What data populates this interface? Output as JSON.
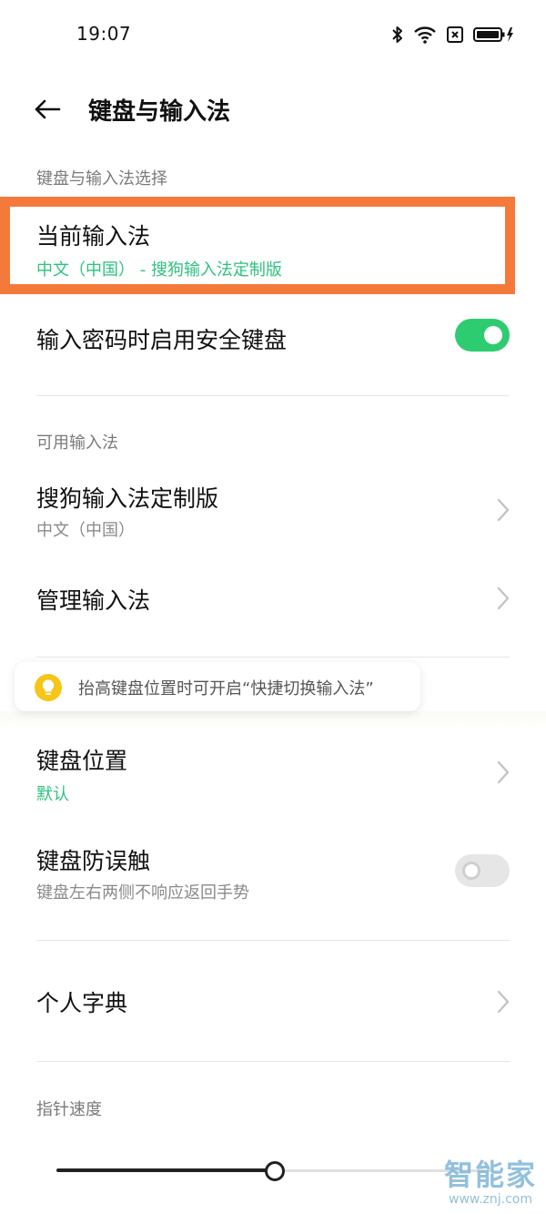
{
  "status_bar": {
    "time": "19:07"
  },
  "header": {
    "title": "键盘与输入法"
  },
  "sections": {
    "keyboard_select": "键盘与输入法选择",
    "available": "可用输入法",
    "pointer_speed": "指针速度"
  },
  "rows": {
    "current_ime": {
      "title": "当前输入法",
      "subtitle": "中文（中国） - 搜狗输入法定制版"
    },
    "secure_keyboard": {
      "title": "输入密码时启用安全键盘",
      "enabled": true
    },
    "sogou": {
      "title": "搜狗输入法定制版",
      "subtitle": "中文（中国）"
    },
    "manage": {
      "title": "管理输入法"
    },
    "keyboard_position": {
      "title": "键盘位置",
      "subtitle": "默认"
    },
    "anti_touch": {
      "title": "键盘防误触",
      "subtitle": "键盘左右两侧不响应返回手势",
      "enabled": false
    },
    "dictionary": {
      "title": "个人字典"
    }
  },
  "tooltip": {
    "text": "抬高键盘位置时可开启“快捷切换输入法”",
    "icon": "lightbulb-icon"
  },
  "slider": {
    "value": 0.5
  },
  "watermark": {
    "brand": "智能家",
    "url": "www.znj.com"
  },
  "colors": {
    "accent_green": "#2ec27e",
    "toggle_on": "#2ecc71",
    "highlight": "#f47a3c",
    "tip_yellow": "#f5c518"
  }
}
